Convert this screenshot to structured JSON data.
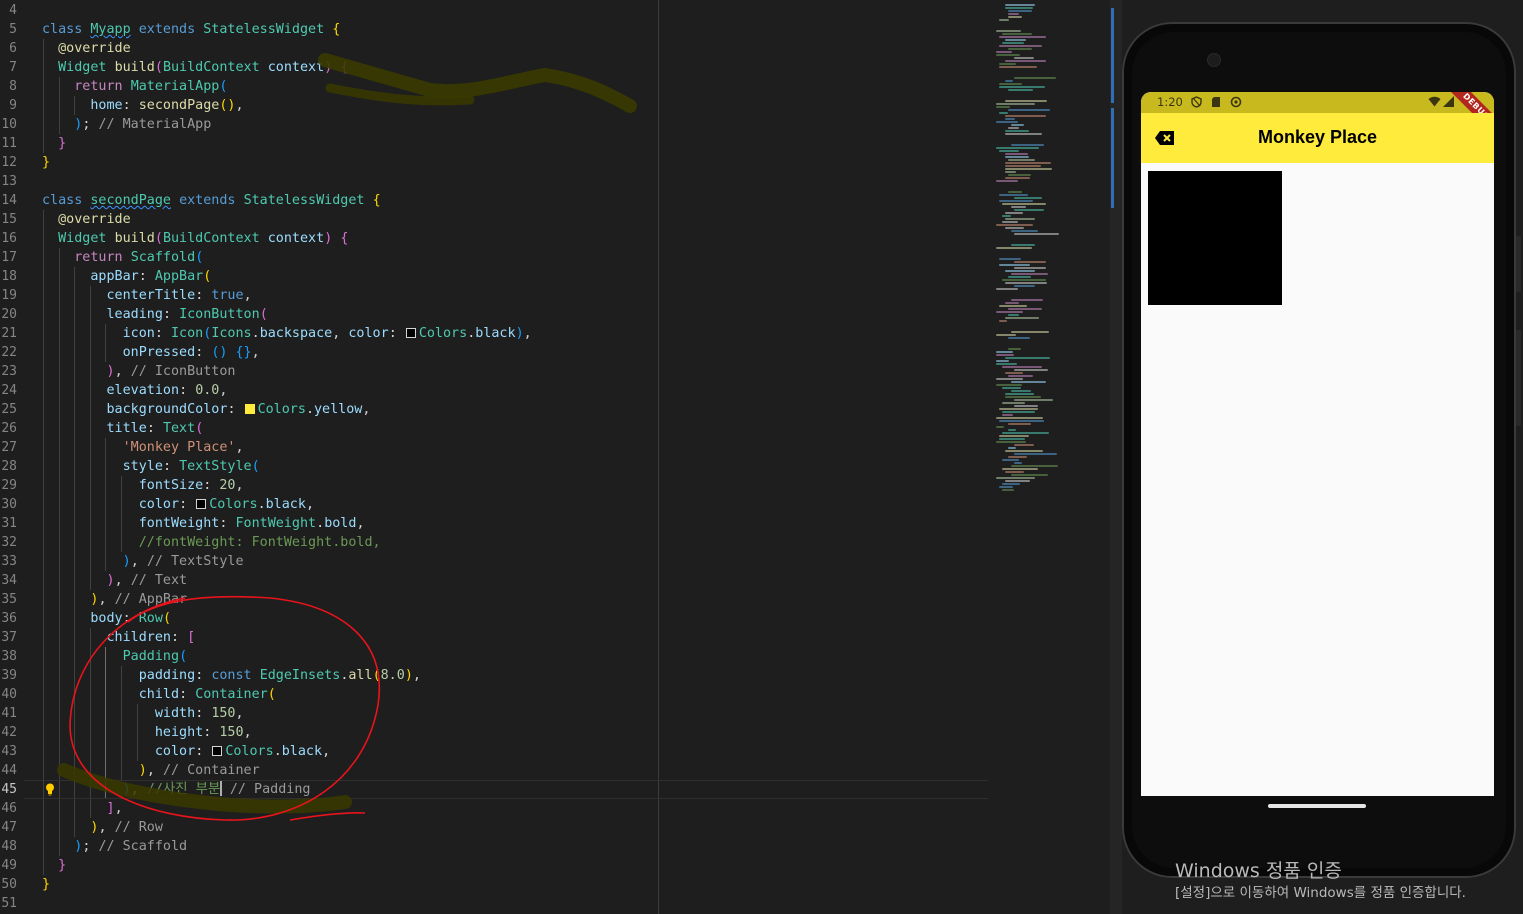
{
  "editor": {
    "current_line": 45,
    "lines": [
      {
        "no": "4",
        "indent": 0,
        "html": ""
      },
      {
        "no": "5",
        "indent": 0,
        "html": "<span class='k'>class</span> <span class='t sq'>Myapp</span> <span class='k'>extends</span> <span class='t'>StatelessWidget</span> <span class='b1'>{</span>"
      },
      {
        "no": "6",
        "indent": 1,
        "html": "  <span class='f'>@override</span>"
      },
      {
        "no": "7",
        "indent": 1,
        "html": "  <span class='t'>Widget</span> <span class='f'>build</span><span class='b2'>(</span><span class='t'>BuildContext</span> <span class='p'>context</span><span class='b2'>)</span> <span class='b2'>{</span>"
      },
      {
        "no": "8",
        "indent": 2,
        "html": "    <span class='ctl'>return</span> <span class='t'>MaterialApp</span><span class='b3'>(</span>"
      },
      {
        "no": "9",
        "indent": 3,
        "html": "      <span class='p'>home</span>: <span class='f'>secondPage</span><span class='b1'>()</span>,"
      },
      {
        "no": "10",
        "indent": 2,
        "html": "    <span class='b3'>)</span>; <span class='cl'>// MaterialApp</span>"
      },
      {
        "no": "11",
        "indent": 1,
        "html": "  <span class='b2'>}</span>"
      },
      {
        "no": "12",
        "indent": 0,
        "html": "<span class='b1'>}</span>"
      },
      {
        "no": "13",
        "indent": 0,
        "html": ""
      },
      {
        "no": "14",
        "indent": 0,
        "html": "<span class='k'>class</span> <span class='t sq'>secondPage</span> <span class='k'>extends</span> <span class='t'>StatelessWidget</span> <span class='b1'>{</span>"
      },
      {
        "no": "15",
        "indent": 1,
        "html": "  <span class='f'>@override</span>"
      },
      {
        "no": "16",
        "indent": 1,
        "html": "  <span class='t'>Widget</span> <span class='f'>build</span><span class='b2'>(</span><span class='t'>BuildContext</span> <span class='p'>context</span><span class='b2'>)</span> <span class='b2'>{</span>"
      },
      {
        "no": "17",
        "indent": 2,
        "html": "    <span class='ctl'>return</span> <span class='t'>Scaffold</span><span class='b3'>(</span>"
      },
      {
        "no": "18",
        "indent": 3,
        "html": "      <span class='p'>appBar</span>: <span class='t'>AppBar</span><span class='b1'>(</span>"
      },
      {
        "no": "19",
        "indent": 4,
        "html": "        <span class='p'>centerTitle</span>: <span class='k'>true</span>,"
      },
      {
        "no": "20",
        "indent": 4,
        "html": "        <span class='p'>leading</span>: <span class='t'>IconButton</span><span class='b2'>(</span>"
      },
      {
        "no": "21",
        "indent": 5,
        "html": "          <span class='p'>icon</span>: <span class='t'>Icon</span><span class='b3'>(</span><span class='t'>Icons</span>.<span class='p'>backspace</span>, <span class='p'>color</span>: <span class='sw' style='background:#000'></span><span class='t'>Colors</span>.<span class='p'>black</span><span class='b3'>)</span>,"
      },
      {
        "no": "22",
        "indent": 5,
        "html": "          <span class='p'>onPressed</span>: <span class='b3'>()</span> <span class='b3'>{}</span>,"
      },
      {
        "no": "23",
        "indent": 4,
        "html": "        <span class='b2'>)</span>, <span class='cl'>// IconButton</span>"
      },
      {
        "no": "24",
        "indent": 4,
        "html": "        <span class='p'>elevation</span>: <span class='n'>0.0</span>,"
      },
      {
        "no": "25",
        "indent": 4,
        "html": "        <span class='p'>backgroundColor</span>: <span class='sw' style='background:#ffeb3b;border-color:#ffeb3b'></span><span class='t'>Colors</span>.<span class='p'>yellow</span>,"
      },
      {
        "no": "26",
        "indent": 4,
        "html": "        <span class='p'>title</span>: <span class='t'>Text</span><span class='b2'>(</span>"
      },
      {
        "no": "27",
        "indent": 5,
        "html": "          <span class='s'>'Monkey Place'</span>,"
      },
      {
        "no": "28",
        "indent": 5,
        "html": "          <span class='p'>style</span>: <span class='t'>TextStyle</span><span class='b3'>(</span>"
      },
      {
        "no": "29",
        "indent": 6,
        "html": "            <span class='p'>fontSize</span>: <span class='n'>20</span>,"
      },
      {
        "no": "30",
        "indent": 6,
        "html": "            <span class='p'>color</span>: <span class='sw' style='background:#000'></span><span class='t'>Colors</span>.<span class='p'>black</span>,"
      },
      {
        "no": "31",
        "indent": 6,
        "html": "            <span class='p'>fontWeight</span>: <span class='t'>FontWeight</span>.<span class='p'>bold</span>,"
      },
      {
        "no": "32",
        "indent": 6,
        "html": "            <span class='c'>//fontWeight: FontWeight.bold,</span>"
      },
      {
        "no": "33",
        "indent": 5,
        "html": "          <span class='b3'>)</span>, <span class='cl'>// TextStyle</span>"
      },
      {
        "no": "34",
        "indent": 4,
        "html": "        <span class='b2'>)</span>, <span class='cl'>// Text</span>"
      },
      {
        "no": "35",
        "indent": 3,
        "html": "      <span class='b1'>)</span>, <span class='cl'>// AppBar</span>"
      },
      {
        "no": "36",
        "indent": 3,
        "html": "      <span class='p'>body</span>: <span class='t'>Row</span><span class='b1'>(</span>"
      },
      {
        "no": "37",
        "indent": 4,
        "html": "        <span class='p'>children</span>: <span class='b2'>[</span>"
      },
      {
        "no": "38",
        "indent": 5,
        "html": "          <span class='t'>Padding</span><span class='b3'>(</span>"
      },
      {
        "no": "39",
        "indent": 6,
        "html": "            <span class='p'>padding</span>: <span class='k'>const</span> <span class='t'>EdgeInsets</span>.<span class='f'>all</span><span class='b1'>(</span><span class='n'>8.0</span><span class='b1'>)</span>,"
      },
      {
        "no": "40",
        "indent": 6,
        "html": "            <span class='p'>child</span>: <span class='t'>Container</span><span class='b1'>(</span>"
      },
      {
        "no": "41",
        "indent": 7,
        "html": "              <span class='p'>width</span>: <span class='n'>150</span>,"
      },
      {
        "no": "42",
        "indent": 7,
        "html": "              <span class='p'>height</span>: <span class='n'>150</span>,"
      },
      {
        "no": "43",
        "indent": 7,
        "html": "              <span class='p'>color</span>: <span class='sw' style='background:#000'></span><span class='t'>Colors</span>.<span class='p'>black</span>,"
      },
      {
        "no": "44",
        "indent": 6,
        "html": "            <span class='b1'>)</span>, <span class='cl'>// Container</span>"
      },
      {
        "no": "45",
        "indent": 5,
        "html": "          <span class='b3'>)</span>, <span class='c'>//사진 부분</span><span class='caret'></span> <span class='cl'>// Padding</span>"
      },
      {
        "no": "46",
        "indent": 4,
        "html": "        <span class='b2'>]</span>,"
      },
      {
        "no": "47",
        "indent": 3,
        "html": "      <span class='b1'>)</span>, <span class='cl'>// Row</span>"
      },
      {
        "no": "48",
        "indent": 2,
        "html": "    <span class='b3'>)</span>; <span class='cl'>// Scaffold</span>"
      },
      {
        "no": "49",
        "indent": 1,
        "html": "  <span class='b2'>}</span>"
      },
      {
        "no": "50",
        "indent": 0,
        "html": "<span class='b1'>}</span>"
      },
      {
        "no": "51",
        "indent": 0,
        "html": ""
      }
    ]
  },
  "phone": {
    "status_time": "1:20",
    "status_icons": [
      "shield-icon",
      "sd-card-icon",
      "sync-icon"
    ],
    "status_right_icons": [
      "wifi-icon",
      "signal-icon"
    ],
    "debug_banner": "DEBUG",
    "appbar": {
      "title": "Monkey Place",
      "background": "#ffeb3b",
      "leading_icon": "backspace-icon"
    },
    "body": {
      "container_color": "#000000"
    }
  },
  "watermark": {
    "title": "Windows 정품 인증",
    "subtitle": "[설정]으로 이동하여 Windows를 정품 인증합니다."
  },
  "colors": {
    "editor_bg": "#1e1e1e",
    "annotation_red": "#e8141b",
    "scribble": "#3a3a00"
  }
}
